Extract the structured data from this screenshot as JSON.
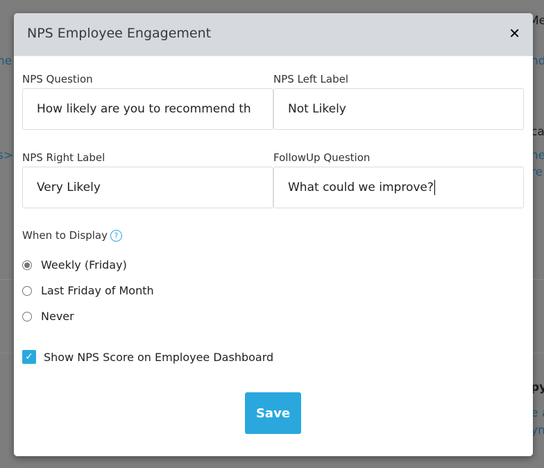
{
  "background": {
    "fragments": [
      "Me",
      "he",
      "nd",
      "s>",
      "ca",
      "ne",
      "re",
      "py",
      "e a",
      "yn"
    ]
  },
  "modal": {
    "title": "NPS Employee Engagement",
    "close_icon": "close-icon",
    "fields": [
      {
        "label": "NPS Question",
        "value": "How likely are you to recommend th"
      },
      {
        "label": "NPS Left Label",
        "value": "Not Likely"
      },
      {
        "label": "NPS Right Label",
        "value": "Very Likely"
      },
      {
        "label": "FollowUp Question",
        "value": "What could we improve?"
      }
    ],
    "when_to_display": {
      "label": "When to Display",
      "help_icon": "?",
      "options": [
        {
          "label": "Weekly (Friday)",
          "selected": true
        },
        {
          "label": "Last Friday of Month",
          "selected": false
        },
        {
          "label": "Never",
          "selected": false
        }
      ]
    },
    "show_score": {
      "label": "Show NPS Score on Employee Dashboard",
      "checked": true
    },
    "save_label": "Save",
    "accent_color": "#2aa8de"
  }
}
